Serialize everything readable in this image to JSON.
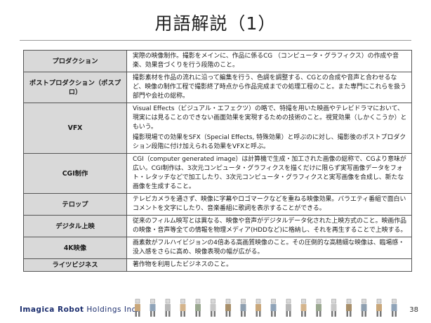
{
  "slide": {
    "title": "用語解説（1）",
    "page_number": "38"
  },
  "footer": {
    "brand_bold": "Imagica Robot",
    "brand_rest": " Holdings Inc."
  },
  "glossary": [
    {
      "term": "プロダクション",
      "definition": [
        "実際の映像制作。撮影をメインに、作品に係るCG （コンピュータ・グラフィクス）の作成や音楽、効果音づくりを行う段階のこと。"
      ]
    },
    {
      "term": "ポストプロダクション（ポスプロ）",
      "definition": [
        "撮影素材を作品の流れに沿って編集を行う、色調を調整する、CGとの合成や音声と合わせるなど、映像の制作工程で撮影終了時点から作品完成までの処理工程のこと。また専門にこれらを扱う部門や会社の総称。"
      ]
    },
    {
      "term": "VFX",
      "definition": [
        "Visual Effects（ビジュアル・エフェクツ）の略で、特撮を用いた映画やテレビドラマにおいて、現実には見ることのできない画面効果を実現するための技術のこと。視覚効果（しかくこうか）ともいう。",
        "撮影現場での効果をSFX（Special Effects, 特殊効果）と呼ぶのに対し、撮影後のポストプロダクション段階に付け加えられる効果をVFXと呼ぶ。"
      ]
    },
    {
      "term": "CGI制作",
      "definition": [
        "CGI（computer generated image）は計算機で生成・加工された画像の総称で、CGより意味が広い。CGI制作は、3次元コンピュータ・グラフィクスを描くだけに限らず実写画像データをフォト・レタッチなどで加工したり、3次元コンピュータ・グラフィクスと実写画像を合成し、新たな画像を生成すること。"
      ]
    },
    {
      "term": "テロップ",
      "definition": [
        "テレビカメラを通さず、映像に字幕やロゴマークなどを重ねる映像効果。バラエティ番組で面白いコメントを文字にしたり、音楽番組に歌詞を表示することができる。"
      ]
    },
    {
      "term": "デジタル上映",
      "definition": [
        "従来のフィルム映写とは異なる、映像や音声がデジタルデータ化された上映方式のこと。映画作品の映像・音声等全ての情報を物理メディア(HDDなど)に格納し、それを再生することで上映する。"
      ]
    },
    {
      "term": "4K映像",
      "definition": [
        "画素数がフルハイビジョンの4倍ある高画質映像のこと。その圧倒的な高精細な映像は、臨場感・没入感をさらに高め、映像表現の幅が広がる。"
      ]
    },
    {
      "term": "ライツビジネス",
      "definition": [
        "著作物を利用したビジネスのこと。"
      ]
    }
  ]
}
